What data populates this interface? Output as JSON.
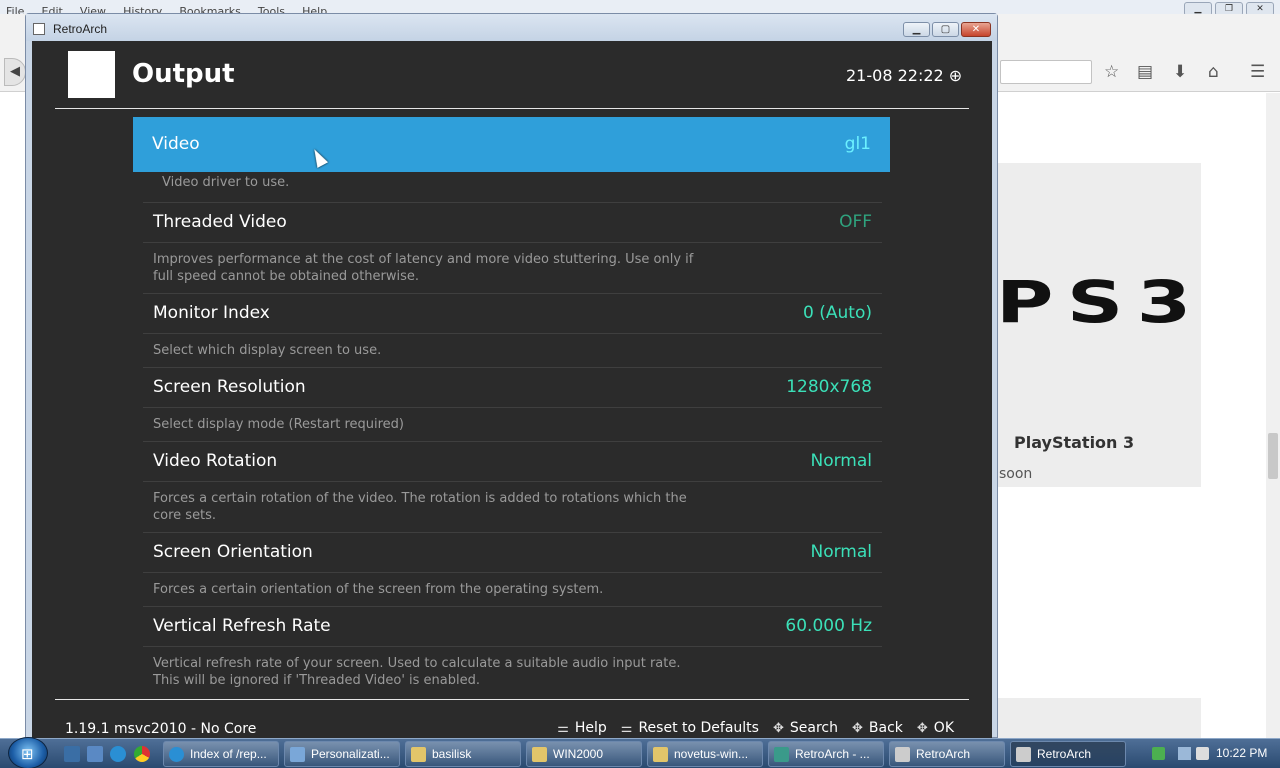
{
  "browser": {
    "menu": [
      "File",
      "Edit",
      "View",
      "History",
      "Bookmarks",
      "Tools",
      "Help"
    ],
    "page": {
      "card_title": "PlayStation 3",
      "card_sub": "soon",
      "logo_text": "PS3"
    }
  },
  "window": {
    "title": "RetroArch"
  },
  "retroarch": {
    "heading": "Output",
    "clock": "21-08 22:22 ⊕",
    "entries": [
      {
        "label": "Video",
        "value": "gl1",
        "desc": "Video driver to use."
      },
      {
        "label": "Threaded Video",
        "value": "OFF",
        "desc": "Improves performance at the cost of latency and more video stuttering. Use only if full speed cannot be obtained otherwise."
      },
      {
        "label": "Monitor Index",
        "value": "0 (Auto)",
        "desc": "Select which display screen to use."
      },
      {
        "label": "Screen Resolution",
        "value": "1280x768",
        "desc": "Select display mode (Restart required)"
      },
      {
        "label": "Video Rotation",
        "value": "Normal",
        "desc": "Forces a certain rotation of the video. The rotation is added to rotations which the core sets."
      },
      {
        "label": "Screen Orientation",
        "value": "Normal",
        "desc": "Forces a certain orientation of the screen from the operating system."
      },
      {
        "label": "Vertical Refresh Rate",
        "value": "60.000 Hz",
        "desc": "Vertical refresh rate of your screen. Used to calculate a suitable audio input rate.\nThis will be ignored if 'Threaded Video' is enabled."
      }
    ],
    "version": "1.19.1 msvc2010 - No Core",
    "hints": {
      "help": "Help",
      "reset": "Reset to Defaults",
      "search": "Search",
      "back": "Back",
      "ok": "OK"
    },
    "colors": {
      "accent": "#2f9fda",
      "value": "#3be0b8",
      "off": "#2fa37e"
    }
  },
  "taskbar": {
    "tasks": [
      "Index of /rep...",
      "Personalizati...",
      "basilisk",
      "WIN2000",
      "novetus-win...",
      "RetroArch - ...",
      "RetroArch",
      "RetroArch"
    ],
    "time": "10:22 PM"
  }
}
